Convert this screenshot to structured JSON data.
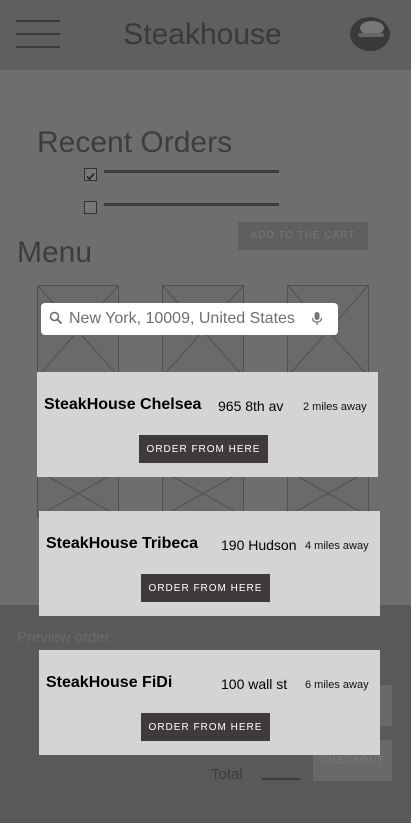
{
  "header": {
    "title": "Steakhouse"
  },
  "recent_orders": {
    "title": "Recent Orders",
    "add_to_cart_label": "ADD TO THE CART"
  },
  "menu": {
    "title": "Menu"
  },
  "search": {
    "value": "New York, 10009, United States"
  },
  "locations": [
    {
      "name": "SteakHouse Chelsea",
      "address": "965 8th av",
      "distance": "2 miles away",
      "button_label": "ORDER FROM HERE"
    },
    {
      "name": "SteakHouse Tribeca",
      "address": "190 Hudson",
      "distance": "4 miles away",
      "button_label": "ORDER FROM HERE"
    },
    {
      "name": "SteakHouse FiDi",
      "address": "100 wall st",
      "distance": "6 miles away",
      "button_label": "ORDER FROM HERE"
    }
  ],
  "preview": {
    "label": "Preview order",
    "checkout_label": "CHECKOUT",
    "total_label": "Total"
  },
  "icons": {
    "menu": "hamburger-menu-icon",
    "burger": "burger-icon",
    "search": "search-icon",
    "mic": "microphone-icon",
    "placeholder": "image-placeholder-icon"
  },
  "colors": {
    "card_bg": "#d4d4d4",
    "button_bg": "#3f3b3b",
    "overlay": "#6e6e6e"
  }
}
